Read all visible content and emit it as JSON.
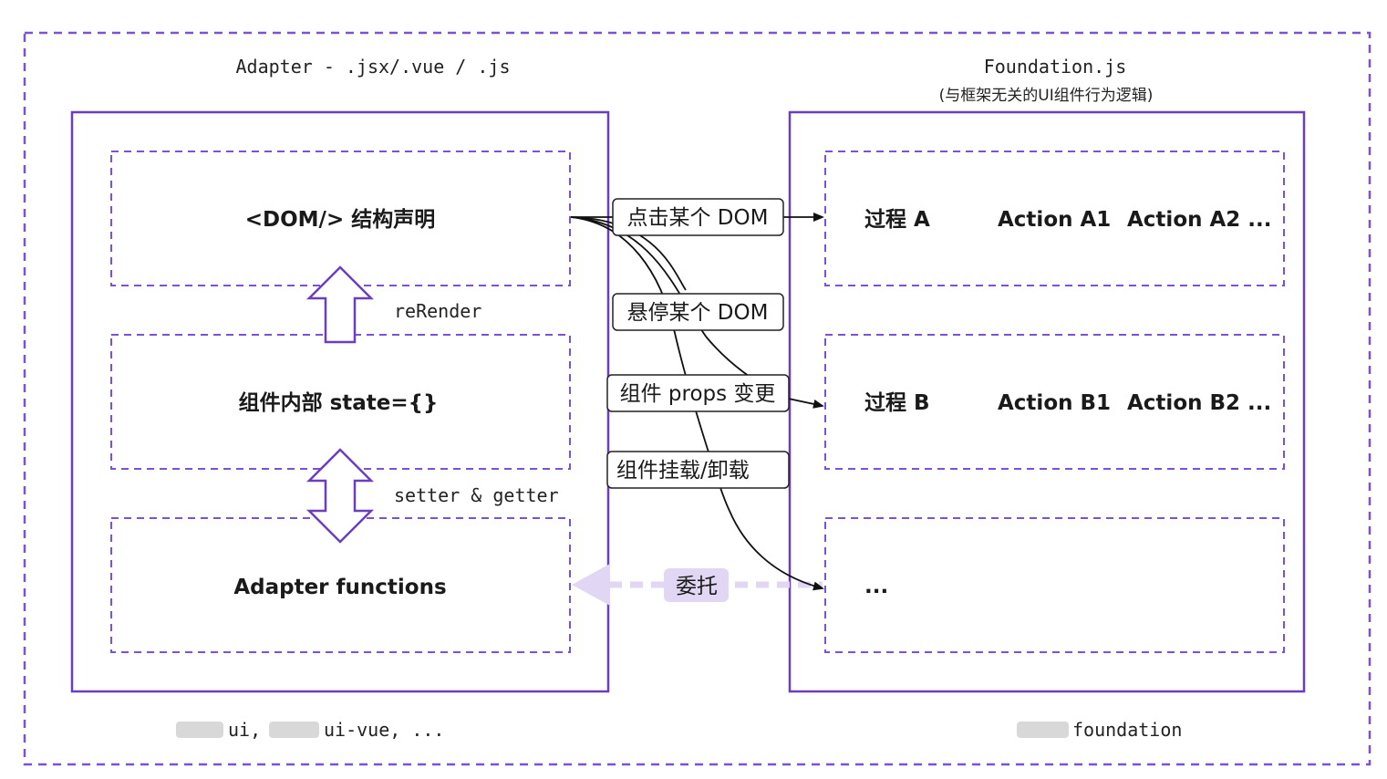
{
  "adapter": {
    "title": "Adapter - .jsx/.vue / .js",
    "dom_box": "<DOM/> 结构声明",
    "state_box": "组件内部 state={}",
    "functions_box": "Adapter functions",
    "rerender_label": "reRender",
    "setter_getter_label": "setter & getter",
    "footer_ui": "ui,",
    "footer_rest": "ui-vue, ..."
  },
  "foundation": {
    "title": "Foundation.js",
    "subtitle": "(与框架无关的UI组件行为逻辑)",
    "rows": [
      {
        "process": "过程 A",
        "action1": "Action A1",
        "action2": "Action A2 ..."
      },
      {
        "process": "过程 B",
        "action1": "Action B1",
        "action2": "Action B2 ..."
      },
      {
        "process": "..."
      }
    ],
    "footer": "foundation"
  },
  "events": {
    "click": "点击某个 DOM",
    "hover": "悬停某个 DOM",
    "props": "组件 props 变更",
    "mount": "组件挂载/卸载"
  },
  "delegate_label": "委托",
  "colors": {
    "purple": "#6a3fbf",
    "dashed_purple": "#7b52d6",
    "light_purple": "#e2d6f5",
    "arrow_black": "#111111"
  }
}
